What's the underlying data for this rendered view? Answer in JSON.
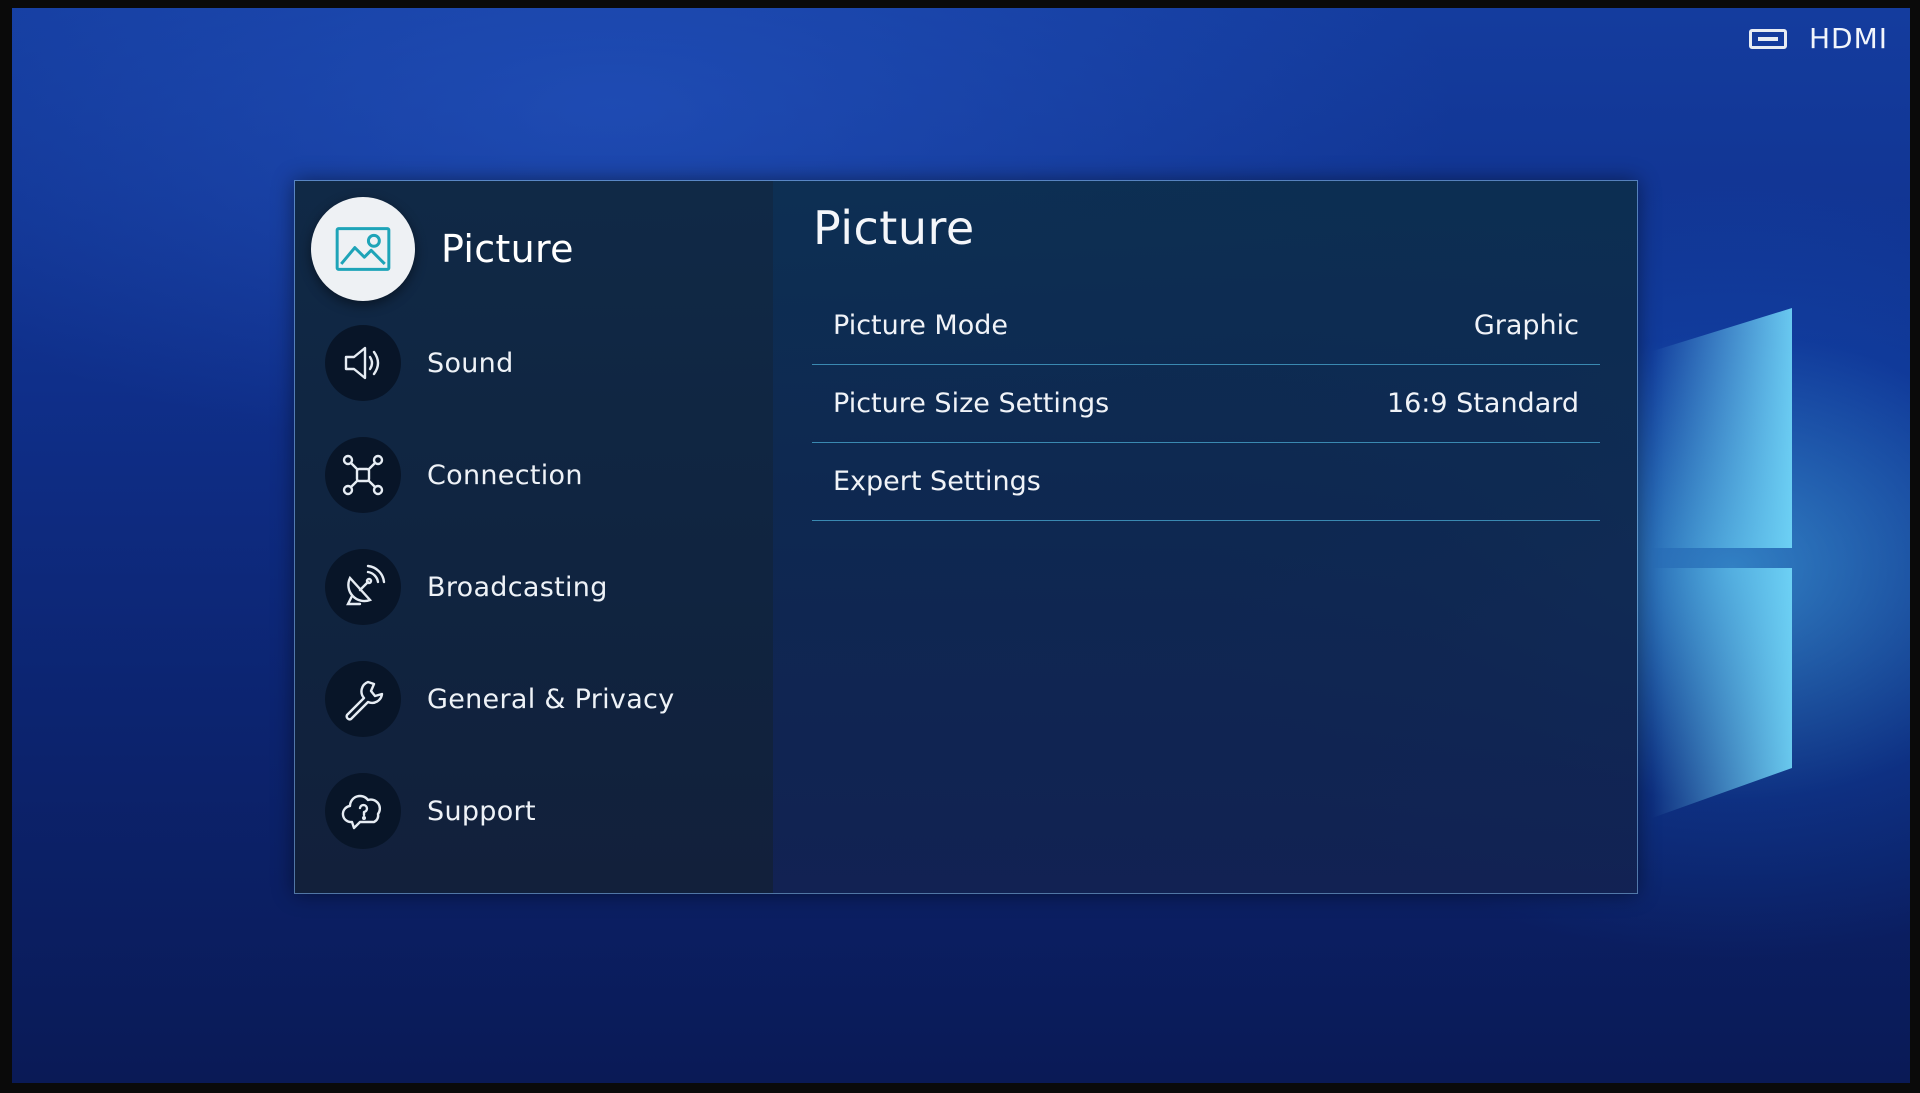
{
  "source": {
    "label": "HDMI",
    "icon": "hdmi-port-icon"
  },
  "nav": {
    "items": [
      {
        "label": "Picture",
        "icon": "picture-icon",
        "active": true
      },
      {
        "label": "Sound",
        "icon": "speaker-icon",
        "active": false
      },
      {
        "label": "Connection",
        "icon": "network-icon",
        "active": false
      },
      {
        "label": "Broadcasting",
        "icon": "satellite-dish-icon",
        "active": false
      },
      {
        "label": "General & Privacy",
        "icon": "wrench-icon",
        "active": false
      },
      {
        "label": "Support",
        "icon": "cloud-question-icon",
        "active": false
      }
    ]
  },
  "content": {
    "title": "Picture",
    "rows": [
      {
        "label": "Picture Mode",
        "value": "Graphic"
      },
      {
        "label": "Picture Size Settings",
        "value": "16:9 Standard"
      },
      {
        "label": "Expert Settings",
        "value": ""
      }
    ]
  },
  "colors": {
    "accent_line": "#4aaad2",
    "active_icon_bg": "#eef1f4",
    "active_icon_stroke": "#1ea4b8"
  }
}
